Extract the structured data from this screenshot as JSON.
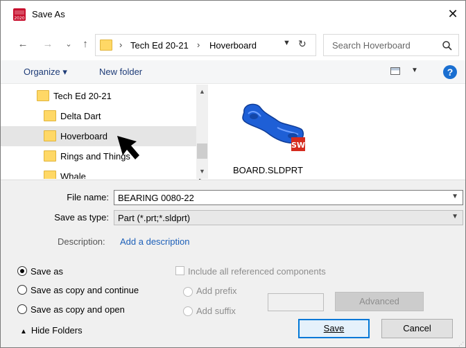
{
  "window": {
    "title": "Save As",
    "app_icon_text": "2020",
    "close_glyph": "✕"
  },
  "nav": {
    "back_glyph": "←",
    "forward_glyph": "→",
    "recent_glyph": "⌄",
    "up_glyph": "↑",
    "breadcrumb": [
      "Tech Ed 20-21",
      "Hoverboard"
    ],
    "separator": "›",
    "refresh_glyph": "↻",
    "search_placeholder": "Search Hoverboard"
  },
  "toolbar": {
    "organize_label": "Organize ▾",
    "new_folder_label": "New folder",
    "help_glyph": "?"
  },
  "tree": {
    "items": [
      {
        "label": "Tech Ed 20-21",
        "level": 0,
        "selected": false
      },
      {
        "label": "Delta Dart",
        "level": 1,
        "selected": false
      },
      {
        "label": "Hoverboard",
        "level": 1,
        "selected": true
      },
      {
        "label": "Rings and Things",
        "level": 1,
        "selected": false
      },
      {
        "label": "Whale",
        "level": 1,
        "selected": false
      }
    ]
  },
  "files": [
    {
      "name": "BOARD.SLDPRT",
      "icon": "solidworks-part-icon"
    }
  ],
  "form": {
    "file_name_label": "File name:",
    "file_name_value": "BEARING 0080-22",
    "save_type_label": "Save as type:",
    "save_type_value": "Part (*.prt;*.sldprt)",
    "description_label": "Description:",
    "description_link": "Add a description"
  },
  "options": {
    "save_modes": [
      {
        "label": "Save as",
        "checked": true
      },
      {
        "label": "Save as copy and continue",
        "checked": false
      },
      {
        "label": "Save as copy and open",
        "checked": false
      }
    ],
    "include_refs_label": "Include all referenced components",
    "add_prefix_label": "Add prefix",
    "add_suffix_label": "Add suffix",
    "advanced_label": "Advanced"
  },
  "footer": {
    "hide_folders_label": "Hide Folders",
    "save_label": "Save",
    "cancel_label": "Cancel"
  },
  "colors": {
    "accent": "#0078d7",
    "link": "#1c5fb8",
    "folder": "#ffd866",
    "solidworks_red": "#d52b1e",
    "part_blue": "#1e5fd6"
  }
}
